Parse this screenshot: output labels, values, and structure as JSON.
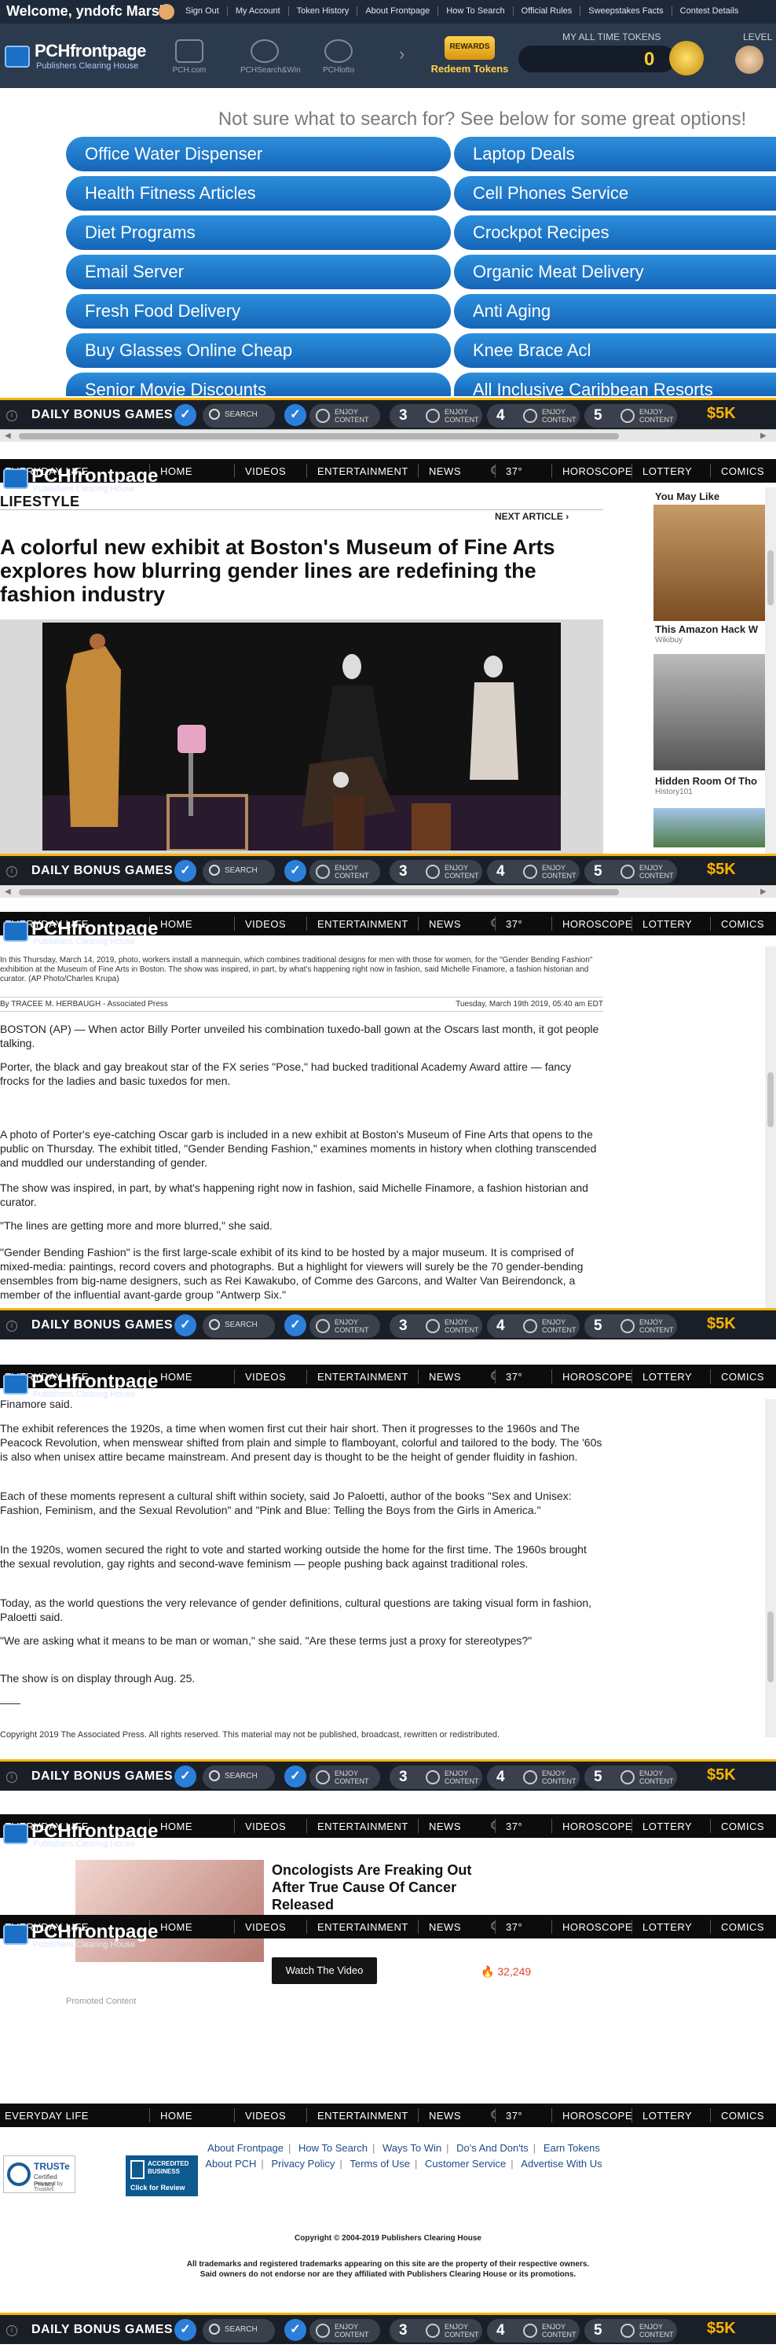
{
  "topbar": {
    "welcome": "Welcome, yndofc Marsh",
    "links": [
      "Sign Out",
      "My Account",
      "Token History",
      "About Frontpage",
      "How To Search",
      "Official Rules",
      "Sweepstakes Facts",
      "Contest Details"
    ]
  },
  "header": {
    "logo_name": "PCHfrontpage",
    "logo_sub": "Publishers Clearing House",
    "nav_icons": [
      {
        "label": "PCH.com",
        "icon": "pch-icon"
      },
      {
        "label": "PCHSearch&Win",
        "icon": "search-win-icon"
      },
      {
        "label": "PCHlotto",
        "icon": "lotto-icon"
      }
    ],
    "rewards_badge": "REWARDS",
    "rewards_label": "Redeem Tokens",
    "tokens_label": "MY ALL TIME TOKENS",
    "tokens_value": "0",
    "level_label": "LEVEL"
  },
  "suggestions": {
    "heading": "Not sure what to search for? See below for some great options!",
    "left": [
      "Office Water Dispenser",
      "Health Fitness Articles",
      "Diet Programs",
      "Email Server",
      "Fresh Food Delivery",
      "Buy Glasses Online Cheap",
      "Senior Movie Discounts"
    ],
    "right": [
      "Laptop Deals",
      "Cell Phones Service",
      "Crockpot Recipes",
      "Organic Meat Delivery",
      "Anti Aging",
      "Knee Brace Acl",
      "All Inclusive Caribbean Resorts"
    ]
  },
  "bonus_bar": {
    "title": "DAILY BONUS GAMES",
    "search_label": "SEARCH",
    "enjoy_label": "ENJOY",
    "content_label": "CONTENT",
    "steps": [
      "3",
      "4",
      "5"
    ],
    "prize": "$5K"
  },
  "catnav": {
    "items": [
      "EVERYDAY LIFE",
      "HOME",
      "VIDEOS",
      "ENTERTAINMENT",
      "NEWS",
      "37°",
      "HOROSCOPE",
      "LOTTERY",
      "COMICS"
    ]
  },
  "article": {
    "section": "LIFESTYLE",
    "next_article": "NEXT ARTICLE",
    "headline": "A colorful new exhibit at Boston's Museum of Fine Arts explores how blurring gender lines are redefining the fashion industry",
    "caption": "In this Thursday, March 14, 2019, photo, workers install a mannequin, which combines traditional designs for men with those for women, for the \"Gender Bending Fashion\" exhibition at the Museum of Fine Arts in Boston. The show was inspired, in part, by what's happening right now in fashion, said Michelle Finamore, a fashion historian and curator. (AP Photo/Charles Krupa)",
    "byline": "By TRACEE M. HERBAUGH - Associated Press",
    "date": "Tuesday, March 19th 2019, 05:40 am EDT",
    "paragraphs": [
      "BOSTON (AP) — When actor Billy Porter unveiled his combination tuxedo-ball gown at the Oscars last month, it got people talking.",
      "Porter, the black and gay breakout star of the FX series \"Pose,\" had bucked traditional Academy Award attire — fancy frocks for the ladies and basic tuxedos for men.",
      "A photo of Porter's eye-catching Oscar garb is included in a new exhibit at Boston's Museum of Fine Arts that opens to the public on Thursday. The exhibit titled, \"Gender Bending Fashion,\" examines moments in history when clothing transcended and muddled our understanding of gender.",
      "The show was inspired, in part, by what's happening right now in fashion, said Michelle Finamore, a fashion historian and curator.",
      "\"The lines are getting more and more blurred,\" she said.",
      "\"Gender Bending Fashion\" is the first large-scale exhibit of its kind to be hosted by a major museum. It is comprised of mixed-media: paintings, record covers and photographs. But a highlight for viewers will surely be the 70 gender-bending ensembles from big-name designers, such as Rei Kawakubo, of Comme des Garcons, and Walter Van Beirendonck, a member of the influential avant-garde group \"Antwerp Six.\"",
      "Finamore said.",
      "The exhibit references the 1920s, a time when women first cut their hair short. Then it progresses to the 1960s and The Peacock Revolution, when menswear shifted from plain and simple to flamboyant, colorful and tailored to the body. The '60s is also when unisex attire became mainstream. And present day is thought to be the height of gender fluidity in fashion.",
      "Each of these moments represent a cultural shift within society, said Jo Paloetti, author of the books \"Sex and Unisex: Fashion, Feminism, and the Sexual Revolution\" and \"Pink and Blue: Telling the Boys from the Girls in America.\"",
      "In the 1920s, women secured the right to vote and started working outside the home for the first time. The 1960s brought the sexual revolution, gay rights and second-wave feminism — people pushing back against traditional roles.",
      "Today, as the world questions the very relevance of gender definitions, cultural questions are taking visual form in fashion, Paloetti said.",
      "\"We are asking what it means to be man or woman,\" she said. \"Are these terms just a proxy for stereotypes?\"",
      "The show is on display through Aug. 25."
    ],
    "copyright": "Copyright 2019 The Associated Press. All rights reserved. This material may not be published, broadcast, rewritten or redistributed."
  },
  "rail": {
    "title": "You May Like",
    "items": [
      {
        "caption": "This Amazon Hack W",
        "source": "Wikibuy"
      },
      {
        "caption": "Hidden Room Of Tho",
        "source": "History101"
      }
    ]
  },
  "promo": {
    "title": "Oncologists Are Freaking Out After True Cause Of Cancer Released",
    "button": "Watch The Video",
    "count": "32,249",
    "label": "Promoted Content"
  },
  "footer": {
    "row1": [
      "About Frontpage",
      "How To Search",
      "Ways To Win",
      "Do's And Don'ts",
      "Earn Tokens"
    ],
    "row2": [
      "About PCH",
      "Privacy Policy",
      "Terms of Use",
      "Customer Service",
      "Advertise With Us"
    ],
    "truste": {
      "t1": "TRUSTe",
      "t2": "Certified Privacy",
      "t3": "Powered by TrustArc"
    },
    "bbb": {
      "t1": "ACCREDITED BUSINESS",
      "t2": "Click for Review"
    },
    "copyright": "Copyright © 2004-2019 Publishers Clearing House",
    "legal1": "All trademarks and registered trademarks appearing on this site are the property of their respective owners.",
    "legal2": "Said owners do not endorse nor are they affiliated with Publishers Clearing House or its promotions."
  }
}
